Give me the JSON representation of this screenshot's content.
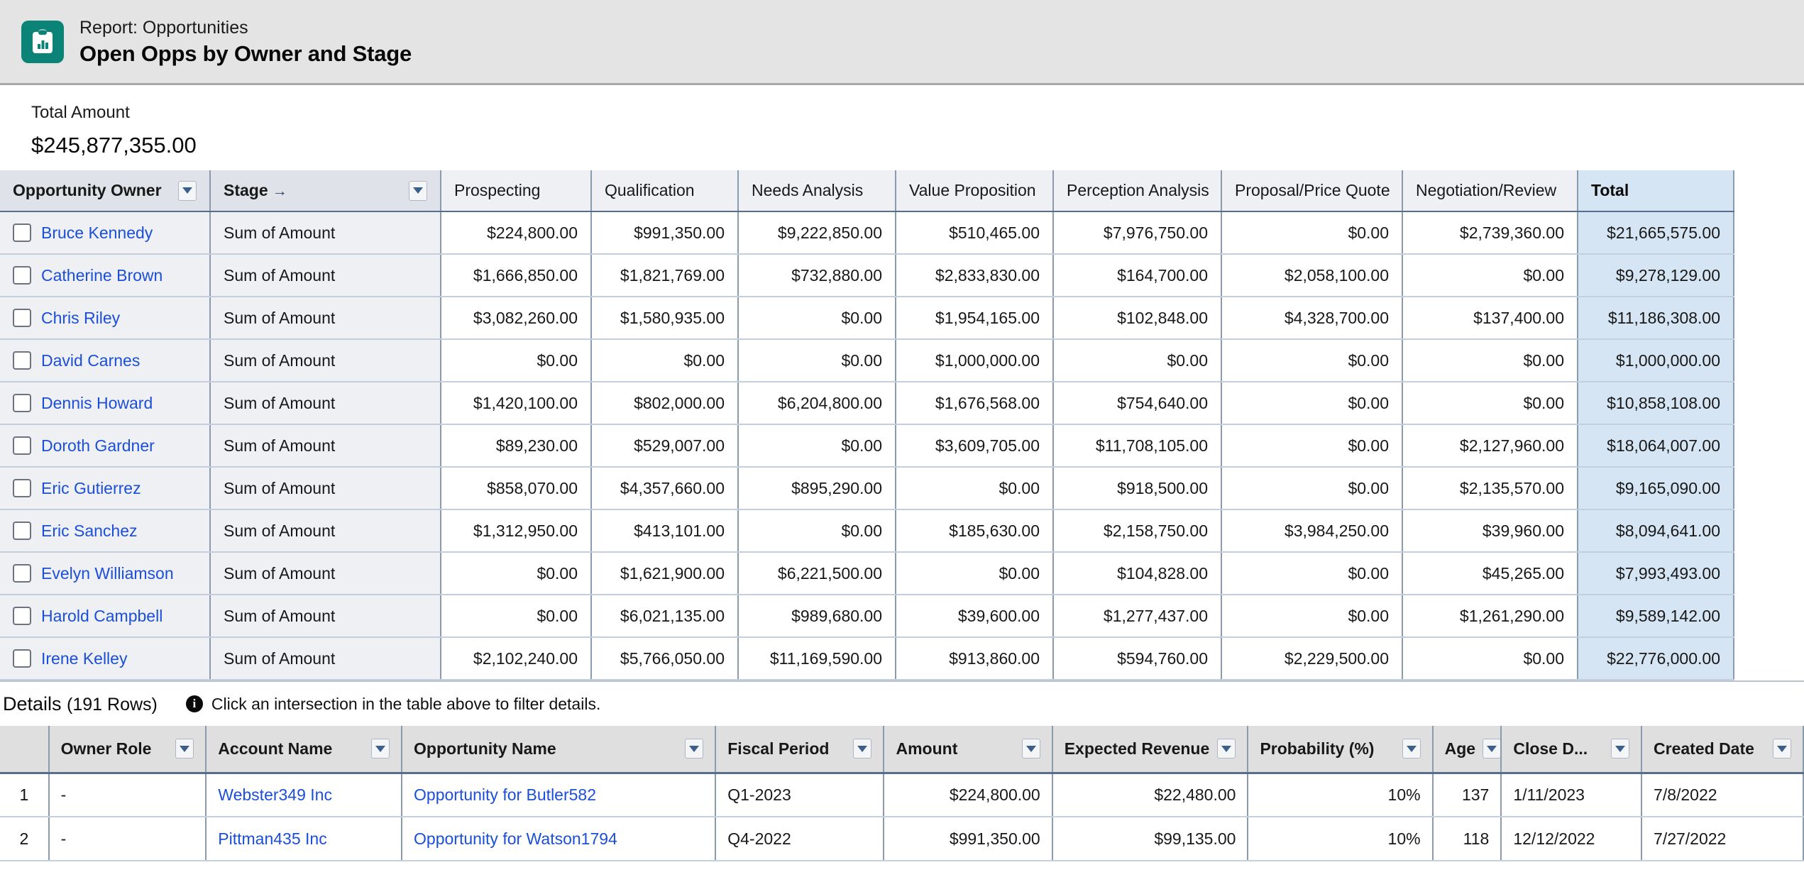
{
  "header": {
    "eyebrow": "Report: Opportunities",
    "title": "Open Opps by Owner and Stage",
    "icon": "report-clipboard-chart-icon",
    "icon_color": "#0b8477"
  },
  "summary": {
    "label": "Total Amount",
    "value": "$245,877,355.00"
  },
  "pivot": {
    "group_headers": [
      {
        "label": "Opportunity Owner",
        "has_menu": true,
        "has_arrow": false
      },
      {
        "label": "Stage",
        "has_menu": true,
        "has_arrow": true,
        "arrow": "→"
      }
    ],
    "stage_columns": [
      "Prospecting",
      "Qualification",
      "Needs Analysis",
      "Value Proposition",
      "Perception Analysis",
      "Proposal/Price Quote",
      "Negotiation/Review"
    ],
    "total_column": "Total",
    "measure_label": "Sum of Amount",
    "rows": [
      {
        "owner": "Bruce Kennedy",
        "measure": "Sum of Amount",
        "values": [
          "$224,800.00",
          "$991,350.00",
          "$9,222,850.00",
          "$510,465.00",
          "$7,976,750.00",
          "$0.00",
          "$2,739,360.00"
        ],
        "total": "$21,665,575.00"
      },
      {
        "owner": "Catherine Brown",
        "measure": "Sum of Amount",
        "values": [
          "$1,666,850.00",
          "$1,821,769.00",
          "$732,880.00",
          "$2,833,830.00",
          "$164,700.00",
          "$2,058,100.00",
          "$0.00"
        ],
        "total": "$9,278,129.00"
      },
      {
        "owner": "Chris Riley",
        "measure": "Sum of Amount",
        "values": [
          "$3,082,260.00",
          "$1,580,935.00",
          "$0.00",
          "$1,954,165.00",
          "$102,848.00",
          "$4,328,700.00",
          "$137,400.00"
        ],
        "total": "$11,186,308.00"
      },
      {
        "owner": "David Carnes",
        "measure": "Sum of Amount",
        "values": [
          "$0.00",
          "$0.00",
          "$0.00",
          "$1,000,000.00",
          "$0.00",
          "$0.00",
          "$0.00"
        ],
        "total": "$1,000,000.00"
      },
      {
        "owner": "Dennis Howard",
        "measure": "Sum of Amount",
        "values": [
          "$1,420,100.00",
          "$802,000.00",
          "$6,204,800.00",
          "$1,676,568.00",
          "$754,640.00",
          "$0.00",
          "$0.00"
        ],
        "total": "$10,858,108.00"
      },
      {
        "owner": "Doroth Gardner",
        "measure": "Sum of Amount",
        "values": [
          "$89,230.00",
          "$529,007.00",
          "$0.00",
          "$3,609,705.00",
          "$11,708,105.00",
          "$0.00",
          "$2,127,960.00"
        ],
        "total": "$18,064,007.00"
      },
      {
        "owner": "Eric Gutierrez",
        "measure": "Sum of Amount",
        "values": [
          "$858,070.00",
          "$4,357,660.00",
          "$895,290.00",
          "$0.00",
          "$918,500.00",
          "$0.00",
          "$2,135,570.00"
        ],
        "total": "$9,165,090.00"
      },
      {
        "owner": "Eric Sanchez",
        "measure": "Sum of Amount",
        "values": [
          "$1,312,950.00",
          "$413,101.00",
          "$0.00",
          "$185,630.00",
          "$2,158,750.00",
          "$3,984,250.00",
          "$39,960.00"
        ],
        "total": "$8,094,641.00"
      },
      {
        "owner": "Evelyn Williamson",
        "measure": "Sum of Amount",
        "values": [
          "$0.00",
          "$1,621,900.00",
          "$6,221,500.00",
          "$0.00",
          "$104,828.00",
          "$0.00",
          "$45,265.00"
        ],
        "total": "$7,993,493.00"
      },
      {
        "owner": "Harold Campbell",
        "measure": "Sum of Amount",
        "values": [
          "$0.00",
          "$6,021,135.00",
          "$989,680.00",
          "$39,600.00",
          "$1,277,437.00",
          "$0.00",
          "$1,261,290.00"
        ],
        "total": "$9,589,142.00"
      },
      {
        "owner": "Irene Kelley",
        "measure": "Sum of Amount",
        "values": [
          "$2,102,240.00",
          "$5,766,050.00",
          "$11,169,590.00",
          "$913,860.00",
          "$594,760.00",
          "$2,229,500.00",
          "$0.00"
        ],
        "total": "$22,776,000.00"
      }
    ]
  },
  "details": {
    "title": "Details",
    "row_count_label": "(191 Rows)",
    "hint": "Click an intersection in the table above to filter details.",
    "columns": [
      {
        "label": "",
        "menu": false
      },
      {
        "label": "Owner Role",
        "menu": true
      },
      {
        "label": "Account Name",
        "menu": true
      },
      {
        "label": "Opportunity Name",
        "menu": true
      },
      {
        "label": "Fiscal Period",
        "menu": true
      },
      {
        "label": "Amount",
        "menu": true
      },
      {
        "label": "Expected Revenue",
        "menu": true
      },
      {
        "label": "Probability (%)",
        "menu": true
      },
      {
        "label": "Age",
        "menu": true
      },
      {
        "label": "Close D...",
        "menu": true
      },
      {
        "label": "Created Date",
        "menu": true
      }
    ],
    "rows": [
      {
        "index": "1",
        "owner_role": "-",
        "account_name": "Webster349 Inc",
        "opportunity_name": "Opportunity for Butler582",
        "fiscal_period": "Q1-2023",
        "amount": "$224,800.00",
        "expected_revenue": "$22,480.00",
        "probability": "10%",
        "age": "137",
        "close_date": "1/11/2023",
        "created_date": "7/8/2022"
      },
      {
        "index": "2",
        "owner_role": "-",
        "account_name": "Pittman435 Inc",
        "opportunity_name": "Opportunity for Watson1794",
        "fiscal_period": "Q4-2022",
        "amount": "$991,350.00",
        "expected_revenue": "$99,135.00",
        "probability": "10%",
        "age": "118",
        "close_date": "12/12/2022",
        "created_date": "7/27/2022"
      }
    ]
  }
}
